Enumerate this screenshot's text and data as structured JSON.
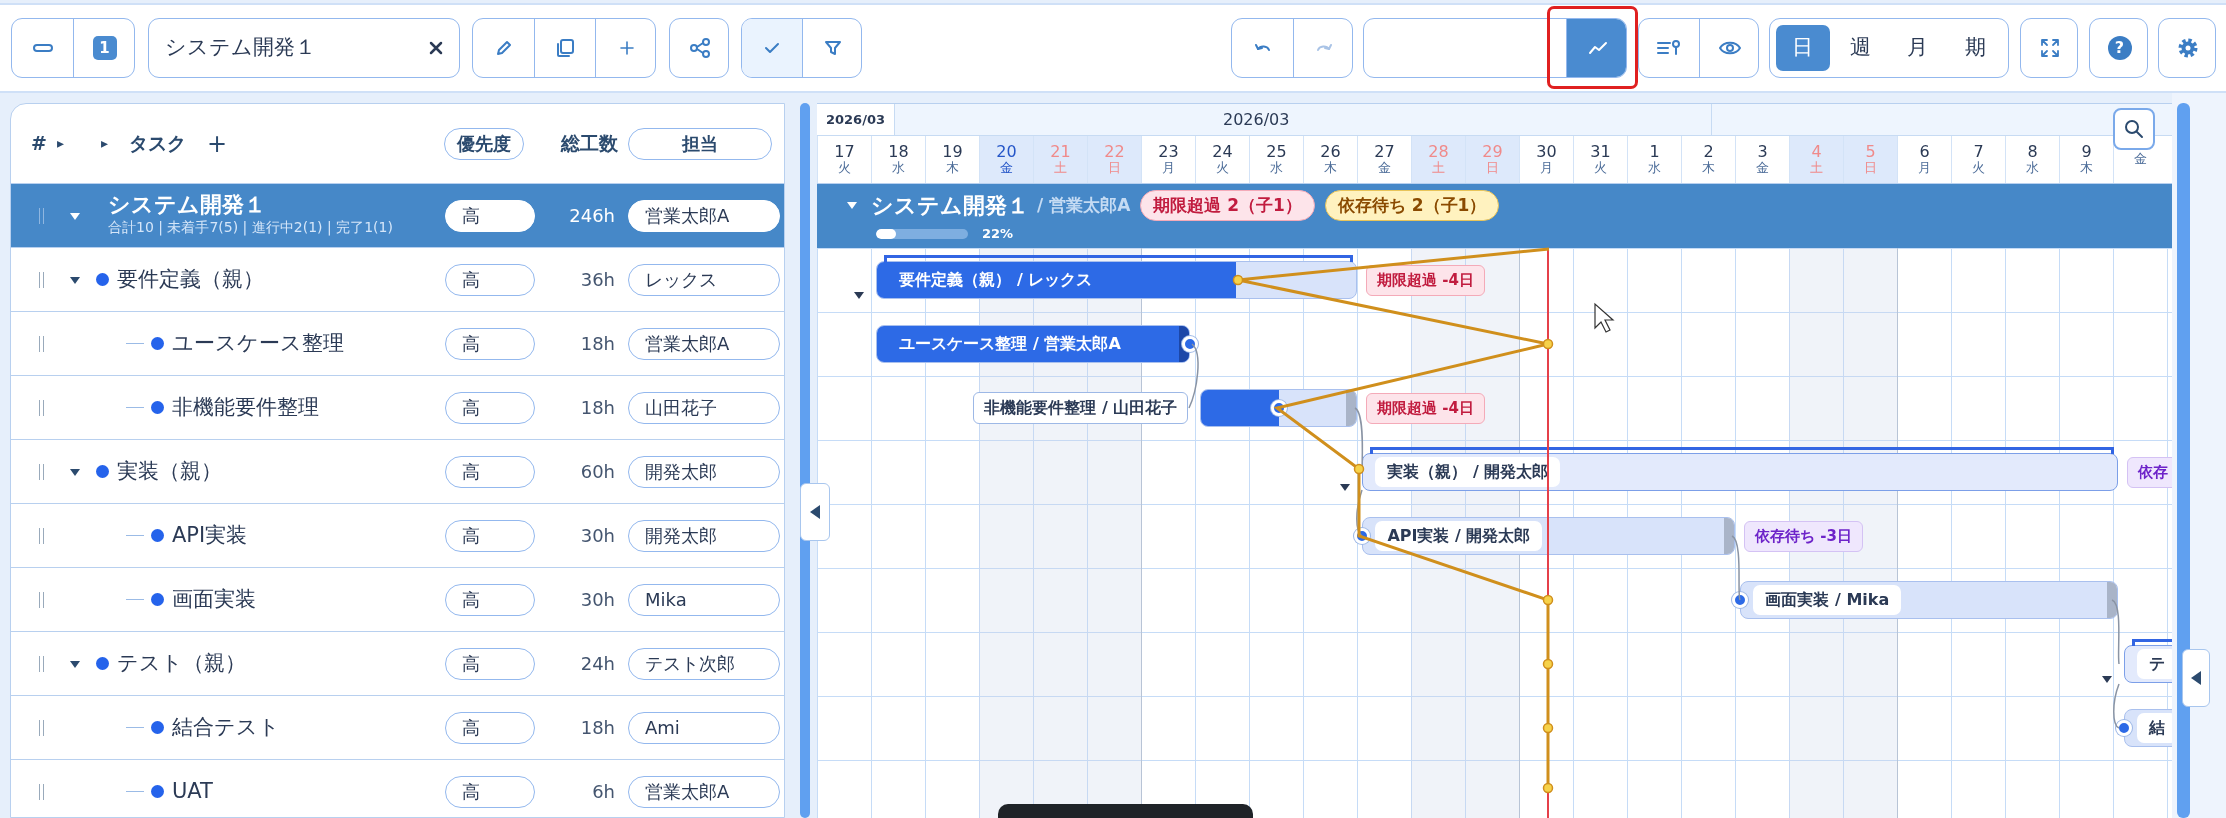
{
  "toolbar": {
    "level_badge": "1",
    "project_field": {
      "value": "システム開発１"
    },
    "check_active": true,
    "redo_disabled": true,
    "chart_selected": true,
    "chart_highlighted": true,
    "help_label": "?",
    "view_modes": [
      {
        "label": "日",
        "selected": true
      },
      {
        "label": "週",
        "selected": false
      },
      {
        "label": "月",
        "selected": false
      },
      {
        "label": "期",
        "selected": false
      }
    ]
  },
  "task_list": {
    "columns": {
      "number": "#",
      "expand_all": "▸",
      "expand_level": "▸",
      "task": "タスク",
      "add": "+",
      "priority": "優先度",
      "effort": "総工数",
      "assignee": "担当"
    },
    "project": {
      "name": "システム開発１",
      "summary": "合計10 | 未着手7(5) | 進行中2(1) | 完了1(1)",
      "priority": "高",
      "effort": "246h",
      "assignee": "営業太郎A",
      "expanded": true
    },
    "tasks": [
      {
        "name": "要件定義（親）",
        "priority": "高",
        "effort": "36h",
        "assignee": "レックス",
        "expanded": true,
        "children": [
          {
            "name": "ユースケース整理",
            "priority": "高",
            "effort": "18h",
            "assignee": "営業太郎A"
          },
          {
            "name": "非機能要件整理",
            "priority": "高",
            "effort": "18h",
            "assignee": "山田花子"
          }
        ]
      },
      {
        "name": "実装（親）",
        "priority": "高",
        "effort": "60h",
        "assignee": "開発太郎",
        "expanded": true,
        "children": [
          {
            "name": "API実装",
            "priority": "高",
            "effort": "30h",
            "assignee": "開発太郎"
          },
          {
            "name": "画面実装",
            "priority": "高",
            "effort": "30h",
            "assignee": "Mika"
          }
        ]
      },
      {
        "name": "テスト（親）",
        "priority": "高",
        "effort": "24h",
        "assignee": "テスト次郎",
        "expanded": true,
        "children": [
          {
            "name": "結合テスト",
            "priority": "高",
            "effort": "18h",
            "assignee": "Ami"
          },
          {
            "name": "UAT",
            "priority": "高",
            "effort": "6h",
            "assignee": "営業太郎A"
          }
        ]
      }
    ]
  },
  "gantt": {
    "corner_month": "2026/03",
    "months": [
      "2026/03"
    ],
    "days": [
      {
        "day": "17",
        "weekday": "火",
        "kind": "weekday"
      },
      {
        "day": "18",
        "weekday": "水",
        "kind": "weekday"
      },
      {
        "day": "19",
        "weekday": "木",
        "kind": "weekday"
      },
      {
        "day": "20",
        "weekday": "金",
        "kind": "holiday"
      },
      {
        "day": "21",
        "weekday": "土",
        "kind": "weekend"
      },
      {
        "day": "22",
        "weekday": "日",
        "kind": "weekend"
      },
      {
        "day": "23",
        "weekday": "月",
        "kind": "weekday"
      },
      {
        "day": "24",
        "weekday": "火",
        "kind": "weekday"
      },
      {
        "day": "25",
        "weekday": "水",
        "kind": "weekday"
      },
      {
        "day": "26",
        "weekday": "木",
        "kind": "weekday"
      },
      {
        "day": "27",
        "weekday": "金",
        "kind": "weekday"
      },
      {
        "day": "28",
        "weekday": "土",
        "kind": "weekend"
      },
      {
        "day": "29",
        "weekday": "日",
        "kind": "weekend"
      },
      {
        "day": "30",
        "weekday": "月",
        "kind": "weekday"
      },
      {
        "day": "31",
        "weekday": "火",
        "kind": "weekday"
      },
      {
        "day": "1",
        "weekday": "水",
        "kind": "weekday"
      },
      {
        "day": "2",
        "weekday": "木",
        "kind": "weekday"
      },
      {
        "day": "3",
        "weekday": "金",
        "kind": "weekday"
      },
      {
        "day": "4",
        "weekday": "土",
        "kind": "weekend"
      },
      {
        "day": "5",
        "weekday": "日",
        "kind": "weekend"
      },
      {
        "day": "6",
        "weekday": "月",
        "kind": "weekday"
      },
      {
        "day": "7",
        "weekday": "火",
        "kind": "weekday"
      },
      {
        "day": "8",
        "weekday": "水",
        "kind": "weekday"
      },
      {
        "day": "9",
        "weekday": "木",
        "kind": "weekday"
      },
      {
        "weekday": "金",
        "kind": "weekday"
      }
    ],
    "summary_bar": {
      "title": "システム開発１",
      "assignee": "/ 営業太郎A",
      "expanded": true,
      "badges": [
        {
          "text": "期限超過 2（子1）",
          "kind": "overdue"
        },
        {
          "text": "依存待ち 2（子1）",
          "kind": "waiting"
        }
      ],
      "progress": {
        "level": 0.22,
        "reading": "22%"
      }
    },
    "bars": [
      {
        "label": "要件定義（親） / レックス",
        "kind": "parent",
        "level": 0.75,
        "badge": {
          "text": "期限超過 -4日",
          "kind": "overdue"
        }
      },
      {
        "label": "ユースケース整理 / 営業太郎A",
        "kind": "task",
        "level": 1
      },
      {
        "label": "非機能要件整理 / 山田花子",
        "kind": "task",
        "level": 0.5,
        "badge": {
          "text": "期限超過 -4日",
          "kind": "overdue"
        }
      },
      {
        "label": "実装（親） / 開発太郎",
        "kind": "parent",
        "badge": {
          "text": "依存",
          "kind": "waiting"
        }
      },
      {
        "label": "API実装 / 開発太郎",
        "kind": "task",
        "badge": {
          "text": "依存待ち -3日",
          "kind": "waiting"
        }
      },
      {
        "label": "画面実装 / Mika",
        "kind": "task"
      },
      {
        "label": "テ",
        "kind": "parent"
      },
      {
        "label": "結",
        "kind": "task"
      }
    ]
  }
}
